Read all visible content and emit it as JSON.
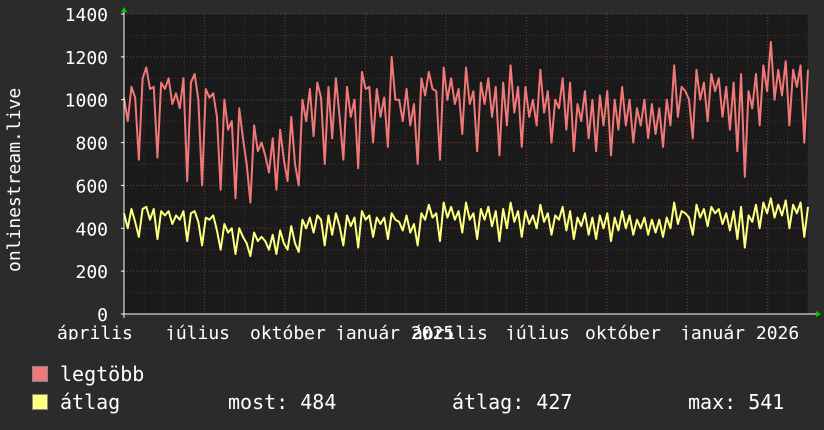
{
  "chart_data": {
    "type": "line",
    "ylabel": "onlinestream.live",
    "ylim": [
      0,
      1400
    ],
    "yticks": [
      0,
      200,
      400,
      600,
      800,
      1000,
      1200,
      1400
    ],
    "xtick_labels": [
      "április",
      "július",
      "október",
      "január 2025",
      "április",
      "július",
      "október",
      "január 2026"
    ],
    "grid": true,
    "series": [
      {
        "name": "legtöbb",
        "color": "#f07878",
        "values": [
          1010,
          900,
          1060,
          1010,
          720,
          1100,
          1150,
          1050,
          1060,
          730,
          1080,
          1050,
          1100,
          980,
          1030,
          960,
          1100,
          620,
          1080,
          1120,
          1000,
          600,
          1050,
          1010,
          1030,
          920,
          580,
          1000,
          860,
          900,
          540,
          960,
          820,
          700,
          520,
          880,
          760,
          800,
          740,
          660,
          820,
          580,
          860,
          720,
          620,
          920,
          700,
          600,
          1000,
          900,
          1050,
          830,
          1080,
          1010,
          700,
          1060,
          820,
          1100,
          920,
          720,
          1060,
          920,
          1000,
          680,
          1130,
          1050,
          1060,
          800,
          1050,
          920,
          1010,
          780,
          1200,
          1000,
          1000,
          900,
          1050,
          880,
          980,
          700,
          1100,
          1020,
          1130,
          1050,
          1040,
          720,
          1150,
          1000,
          1100,
          980,
          1050,
          840,
          1150,
          980,
          1040,
          760,
          1080,
          980,
          1100,
          920,
          1060,
          740,
          1080,
          880,
          1160,
          940,
          1060,
          780,
          1060,
          920,
          1000,
          880,
          1140,
          940,
          1040,
          800,
          1000,
          960,
          1100,
          860,
          1080,
          760,
          980,
          900,
          1040,
          820,
          1000,
          760,
          1020,
          880,
          1040,
          740,
          1000,
          860,
          1060,
          880,
          1000,
          800,
          960,
          880,
          1000,
          820,
          980,
          840,
          960,
          780,
          1000,
          880,
          1160,
          920,
          1060,
          1040,
          1000,
          820,
          1140,
          1000,
          1080,
          900,
          1120,
          1040,
          1100,
          920,
          1060,
          860,
          1080,
          760,
          1120,
          640,
          1040,
          960,
          1120,
          880,
          1160,
          1040,
          1270,
          1000,
          1140,
          1020,
          1180,
          880,
          1140,
          1060,
          1160,
          800,
          1140
        ]
      },
      {
        "name": "átlag",
        "color": "#ffff80",
        "values": [
          470,
          400,
          490,
          430,
          360,
          490,
          500,
          440,
          490,
          350,
          480,
          460,
          480,
          420,
          460,
          440,
          480,
          340,
          470,
          480,
          430,
          320,
          450,
          440,
          460,
          390,
          300,
          420,
          380,
          400,
          280,
          400,
          360,
          330,
          270,
          380,
          340,
          360,
          340,
          300,
          370,
          280,
          390,
          330,
          300,
          410,
          330,
          290,
          440,
          400,
          450,
          380,
          460,
          440,
          320,
          460,
          370,
          470,
          410,
          320,
          460,
          410,
          450,
          310,
          480,
          440,
          460,
          360,
          450,
          420,
          450,
          350,
          470,
          440,
          430,
          390,
          460,
          380,
          420,
          320,
          470,
          440,
          510,
          450,
          470,
          340,
          520,
          450,
          500,
          440,
          480,
          380,
          520,
          440,
          470,
          350,
          490,
          440,
          500,
          410,
          480,
          340,
          490,
          400,
          520,
          430,
          480,
          360,
          480,
          420,
          460,
          400,
          510,
          430,
          470,
          370,
          460,
          440,
          500,
          390,
          480,
          350,
          450,
          410,
          470,
          370,
          450,
          350,
          460,
          400,
          470,
          340,
          450,
          390,
          480,
          400,
          460,
          370,
          440,
          400,
          450,
          370,
          440,
          380,
          440,
          360,
          450,
          400,
          520,
          420,
          480,
          470,
          450,
          370,
          510,
          450,
          490,
          410,
          500,
          470,
          490,
          420,
          470,
          390,
          480,
          350,
          500,
          310,
          460,
          430,
          510,
          400,
          520,
          470,
          540,
          450,
          510,
          460,
          530,
          400,
          510,
          470,
          520,
          360,
          500
        ]
      }
    ]
  },
  "stats": {
    "most": "most: 484",
    "atlag": "átlag: 427",
    "max": "max: 541"
  },
  "colors": {
    "background": "#2b2b2b",
    "plot_background": "#1a1a1a",
    "grid": "#5a3838",
    "axis": "#ffffff"
  }
}
